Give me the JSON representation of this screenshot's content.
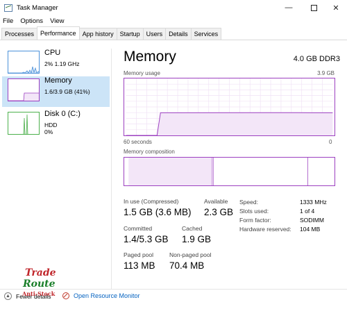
{
  "window": {
    "title": "Task Manager",
    "controls": {
      "minimize": "—",
      "close": "✕"
    }
  },
  "menu": [
    "File",
    "Options",
    "View"
  ],
  "tabs": [
    "Processes",
    "Performance",
    "App history",
    "Startup",
    "Users",
    "Details",
    "Services"
  ],
  "active_tab": "Performance",
  "sidebar": {
    "items": [
      {
        "name": "CPU",
        "detail1": "2% 1.19 GHz",
        "detail2": "",
        "color": "#4a90d9"
      },
      {
        "name": "Memory",
        "detail1": "1.6/3.9 GB (41%)",
        "detail2": "",
        "color": "#9c3fc0"
      },
      {
        "name": "Disk 0 (C:)",
        "detail1": "HDD",
        "detail2": "0%",
        "color": "#4cb04c"
      }
    ],
    "active_item": "Memory"
  },
  "main": {
    "title": "Memory",
    "spec": "4.0 GB DDR3",
    "usage_label": "Memory usage",
    "usage_max": "3.9 GB",
    "time_left": "60 seconds",
    "time_right": "0",
    "composition_label": "Memory composition",
    "accent_color": "#9c3fc0"
  },
  "stats": {
    "in_use": {
      "label": "In use (Compressed)",
      "value": "1.5 GB (3.6 MB)"
    },
    "available": {
      "label": "Available",
      "value": "2.3 GB"
    },
    "committed": {
      "label": "Committed",
      "value": "1.4/5.3 GB"
    },
    "cached": {
      "label": "Cached",
      "value": "1.9 GB"
    },
    "paged_pool": {
      "label": "Paged pool",
      "value": "113 MB"
    },
    "non_paged_pool": {
      "label": "Non-paged pool",
      "value": "70.4 MB"
    }
  },
  "hardware": {
    "speed": {
      "label": "Speed:",
      "value": "1333 MHz"
    },
    "slots": {
      "label": "Slots used:",
      "value": "1 of 4"
    },
    "form": {
      "label": "Form factor:",
      "value": "SODIMM"
    },
    "reserved": {
      "label": "Hardware reserved:",
      "value": "104 MB"
    }
  },
  "footer": {
    "fewer_details": "Fewer details",
    "open_resource_monitor": "Open Resource Monitor"
  },
  "watermark": {
    "line1": "Trade",
    "line2": "Route",
    "line3": "Anti-Stock"
  },
  "chart_data": {
    "type": "area",
    "title": "Memory usage",
    "xlabel": "",
    "ylabel": "",
    "x_range_seconds": [
      60,
      0
    ],
    "y_unit": "GB",
    "ylim": [
      0,
      3.9
    ],
    "series": [
      {
        "x": [
          60,
          51,
          50,
          10,
          6,
          0
        ],
        "values": [
          0,
          0,
          1.55,
          1.56,
          1.55,
          1.55
        ]
      }
    ]
  }
}
